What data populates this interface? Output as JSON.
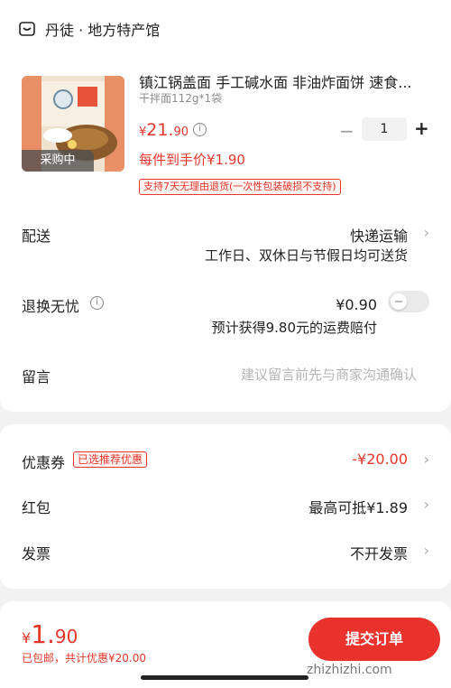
{
  "shop": {
    "name": "丹徒 · 地方特产馆",
    "icon": "shop-icon"
  },
  "product": {
    "title": "镇江锅盖面 手工碱水面 非油炸面饼 速食...",
    "spec": "干拌面112g*1袋",
    "thumb_label": "采购中",
    "price_currency": "¥",
    "price_int": "21.",
    "price_dec": "90",
    "quantity": "1",
    "minus_symbol": "−",
    "plus_symbol": "+",
    "hand_price": "每件到手价¥1.90",
    "return_policy": "支持7天无理由退货(一次性包装破损不支持)"
  },
  "delivery": {
    "label": "配送",
    "value": "快递运输",
    "sub": "工作日、双休日与节假日均可送货"
  },
  "return_insurance": {
    "label": "退换无忧",
    "value": "¥0.90",
    "sub": "预计获得9.80元的运费赔付",
    "enabled": false
  },
  "message": {
    "label": "留言",
    "placeholder": "建议留言前先与商家沟通确认"
  },
  "coupon": {
    "label": "优惠券",
    "tag": "已选推荐优惠",
    "value": "-¥20.00"
  },
  "red_packet": {
    "label": "红包",
    "value": "最高可抵¥1.89"
  },
  "invoice": {
    "label": "发票",
    "value": "不开发票"
  },
  "footer": {
    "currency": "¥",
    "total_int": "1.",
    "total_dec": "90",
    "sub": "已包邮，共计优惠¥20.00",
    "submit": "提交订单"
  },
  "watermark": "zhizhizhi.com",
  "colors": {
    "accent": "#e5372b",
    "button": "#e8322b"
  }
}
